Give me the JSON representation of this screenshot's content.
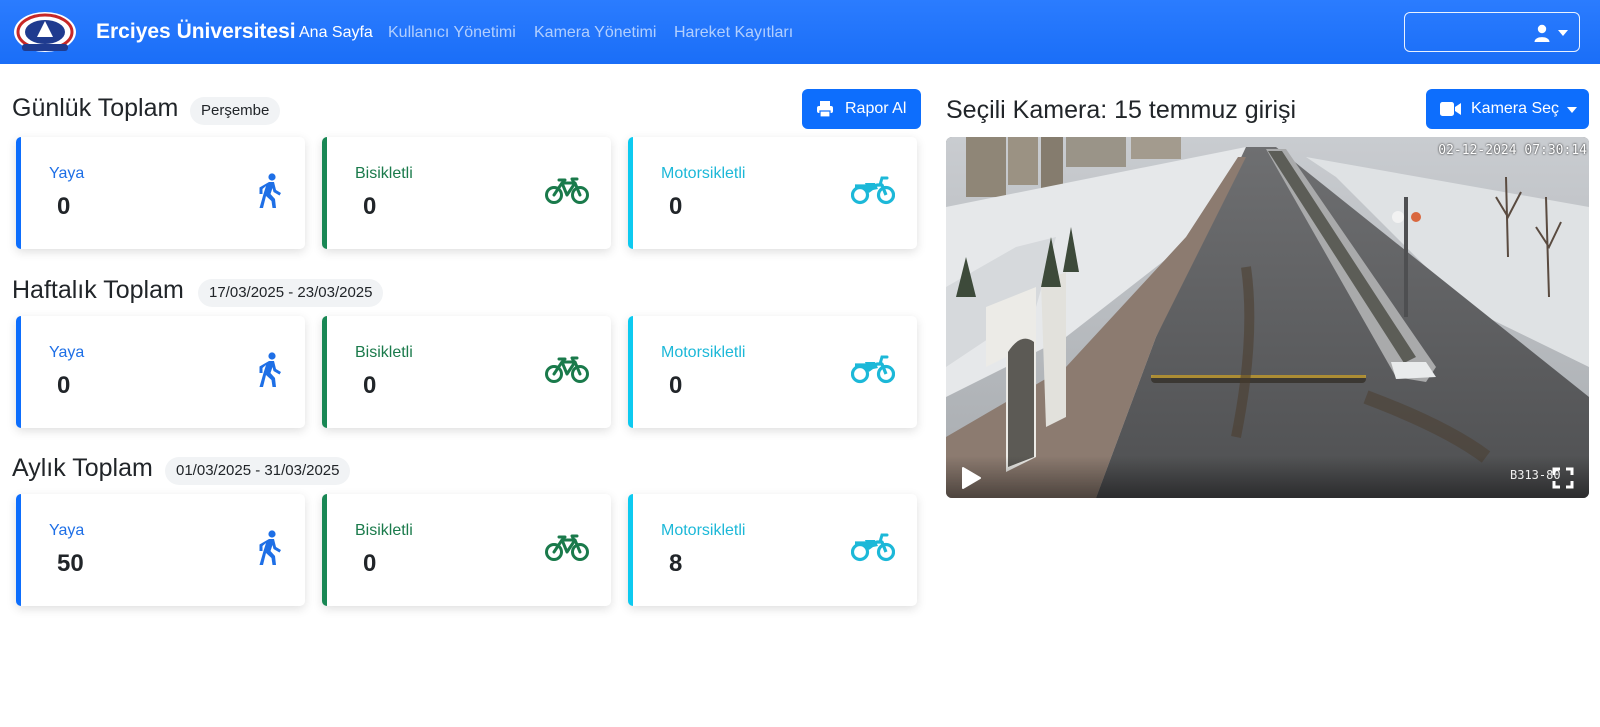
{
  "navbar": {
    "brand": "Erciyes Üniversitesi",
    "logo_icon": "university-seal-icon",
    "links": [
      {
        "label": "Ana Sayfa",
        "active": true
      },
      {
        "label": "Kullanıcı Yönetimi",
        "active": false
      },
      {
        "label": "Kamera Yönetimi",
        "active": false
      },
      {
        "label": "Hareket Kayıtları",
        "active": false
      }
    ],
    "user_icon": "user-icon"
  },
  "report_button": {
    "label": "Rapor Al",
    "icon": "printer-icon"
  },
  "sections": [
    {
      "title": "Günlük Toplam",
      "badge": "Perşembe",
      "cards": [
        {
          "label": "Yaya",
          "value": "0",
          "icon": "walking-icon",
          "color": "#0d6efd"
        },
        {
          "label": "Bisikletli",
          "value": "0",
          "icon": "bicycle-icon",
          "color": "#198754"
        },
        {
          "label": "Motorsikletli",
          "value": "0",
          "icon": "motorcycle-icon",
          "color": "#0dcaf0"
        }
      ]
    },
    {
      "title": "Haftalık Toplam",
      "badge": "17/03/2025 - 23/03/2025",
      "cards": [
        {
          "label": "Yaya",
          "value": "0",
          "icon": "walking-icon",
          "color": "#0d6efd"
        },
        {
          "label": "Bisikletli",
          "value": "0",
          "icon": "bicycle-icon",
          "color": "#198754"
        },
        {
          "label": "Motorsikletli",
          "value": "0",
          "icon": "motorcycle-icon",
          "color": "#0dcaf0"
        }
      ]
    },
    {
      "title": "Aylık Toplam",
      "badge": "01/03/2025 - 31/03/2025",
      "cards": [
        {
          "label": "Yaya",
          "value": "50",
          "icon": "walking-icon",
          "color": "#0d6efd"
        },
        {
          "label": "Bisikletli",
          "value": "0",
          "icon": "bicycle-icon",
          "color": "#198754"
        },
        {
          "label": "Motorsikletli",
          "value": "8",
          "icon": "motorcycle-icon",
          "color": "#0dcaf0"
        }
      ]
    }
  ],
  "camera": {
    "title": "Seçili Kamera: 15 temmuz girişi",
    "select_button": {
      "label": "Kamera Seç",
      "icon": "video-camera-icon"
    },
    "timestamp": "02-12-2024 07:30:14",
    "camera_code": "B313-80",
    "controls": {
      "play_icon": "play-icon",
      "fullscreen_icon": "fullscreen-icon"
    }
  },
  "colors": {
    "navbar": "#1a6ef7",
    "primary": "#0d6efd",
    "success": "#198754",
    "info": "#0dcaf0"
  }
}
